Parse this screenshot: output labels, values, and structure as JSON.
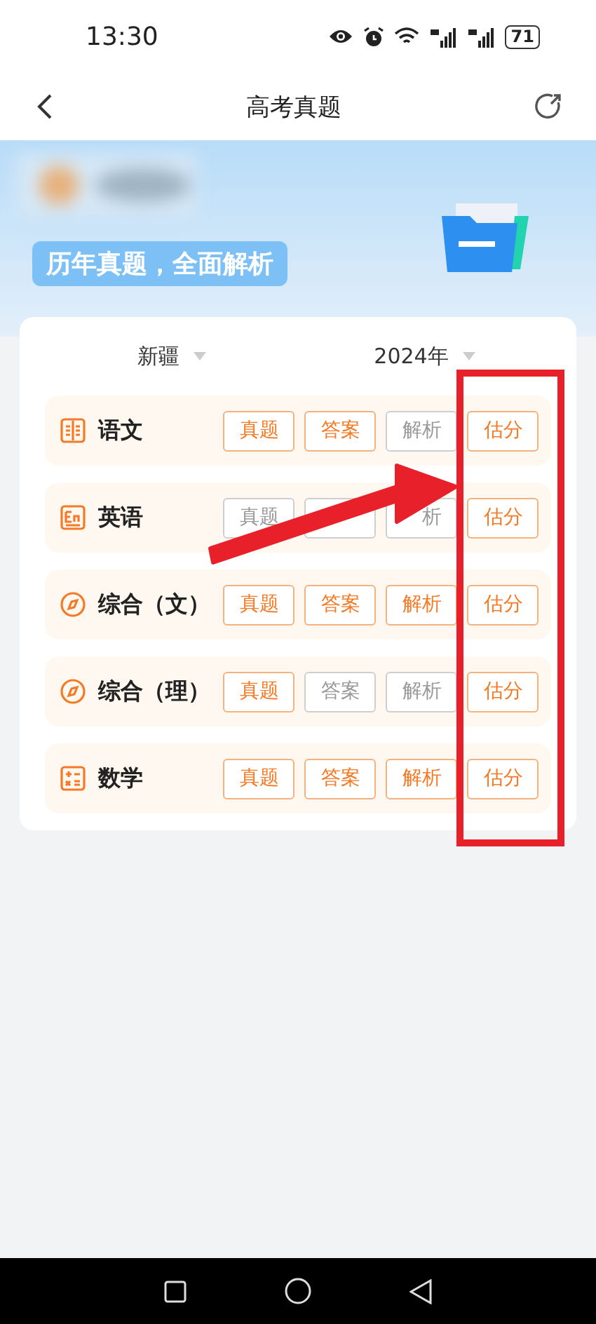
{
  "status_bar": {
    "time": "13:30",
    "battery": "71"
  },
  "header": {
    "title": "高考真题"
  },
  "banner": {
    "tagline": "历年真题，全面解析"
  },
  "filters": [
    {
      "label": "新疆"
    },
    {
      "label": "2024年"
    }
  ],
  "subjects": [
    {
      "name": "语文",
      "buttons": [
        {
          "label": "真题",
          "enabled": true
        },
        {
          "label": "答案",
          "enabled": true
        },
        {
          "label": "解析",
          "enabled": false
        },
        {
          "label": "估分",
          "enabled": true
        }
      ]
    },
    {
      "name": "英语",
      "buttons": [
        {
          "label": "真题",
          "enabled": false
        },
        {
          "enabled": false
        },
        {
          "label": "析",
          "enabled": false
        },
        {
          "label": "估分",
          "enabled": true
        }
      ]
    },
    {
      "name": "综合（文）",
      "buttons": [
        {
          "label": "真题",
          "enabled": true
        },
        {
          "label": "答案",
          "enabled": true
        },
        {
          "label": "解析",
          "enabled": true
        },
        {
          "label": "估分",
          "enabled": true
        }
      ]
    },
    {
      "name": "综合（理）",
      "buttons": [
        {
          "label": "真题",
          "enabled": true
        },
        {
          "label": "答案",
          "enabled": false
        },
        {
          "label": "解析",
          "enabled": false
        },
        {
          "label": "估分",
          "enabled": true
        }
      ]
    },
    {
      "name": "数学",
      "buttons": [
        {
          "label": "真题",
          "enabled": true
        },
        {
          "label": "答案",
          "enabled": true
        },
        {
          "label": "解析",
          "enabled": true
        },
        {
          "label": "估分",
          "enabled": true
        }
      ]
    }
  ]
}
